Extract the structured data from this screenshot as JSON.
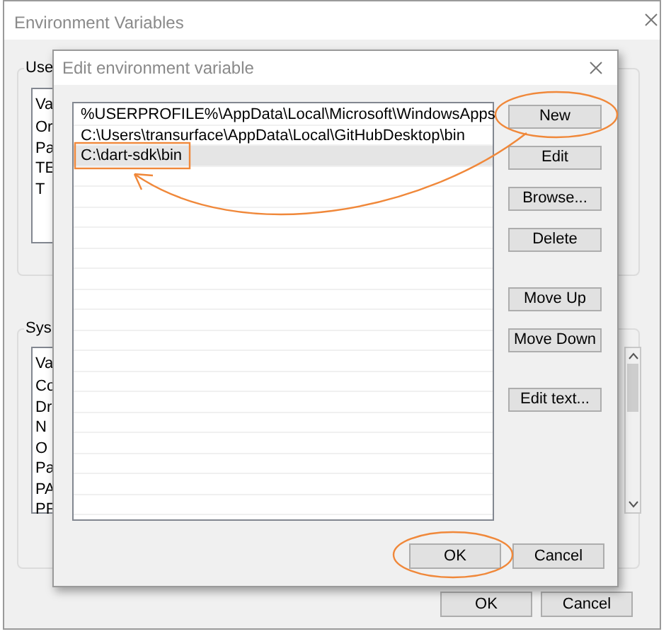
{
  "outer_window": {
    "title": "Environment Variables",
    "user_group": {
      "label": "Use",
      "column_header": "Va",
      "rows": [
        "Or",
        "Pa",
        "TE",
        "T"
      ]
    },
    "system_group": {
      "label": "Sys",
      "column_header": "Va",
      "rows": [
        "Co",
        "Dr",
        "N",
        "O",
        "Pa",
        "PA",
        "PF"
      ]
    },
    "buttons": [
      "OK",
      "Cancel"
    ]
  },
  "dialog": {
    "title": "Edit environment variable",
    "entries": [
      {
        "text": "%USERPROFILE%\\AppData\\Local\\Microsoft\\WindowsApps",
        "selected": false
      },
      {
        "text": "C:\\Users\\transurface\\AppData\\Local\\GitHubDesktop\\bin",
        "selected": false
      },
      {
        "text": "C:\\dart-sdk\\bin",
        "selected": true
      }
    ],
    "button_groups": [
      {
        "buttons": [
          "New",
          "Edit",
          "Browse...",
          "Delete"
        ]
      },
      {
        "buttons": [
          "Move Up",
          "Move Down"
        ]
      },
      {
        "buttons": [
          "Edit text..."
        ]
      }
    ],
    "buttons": [
      "OK",
      "Cancel"
    ]
  }
}
